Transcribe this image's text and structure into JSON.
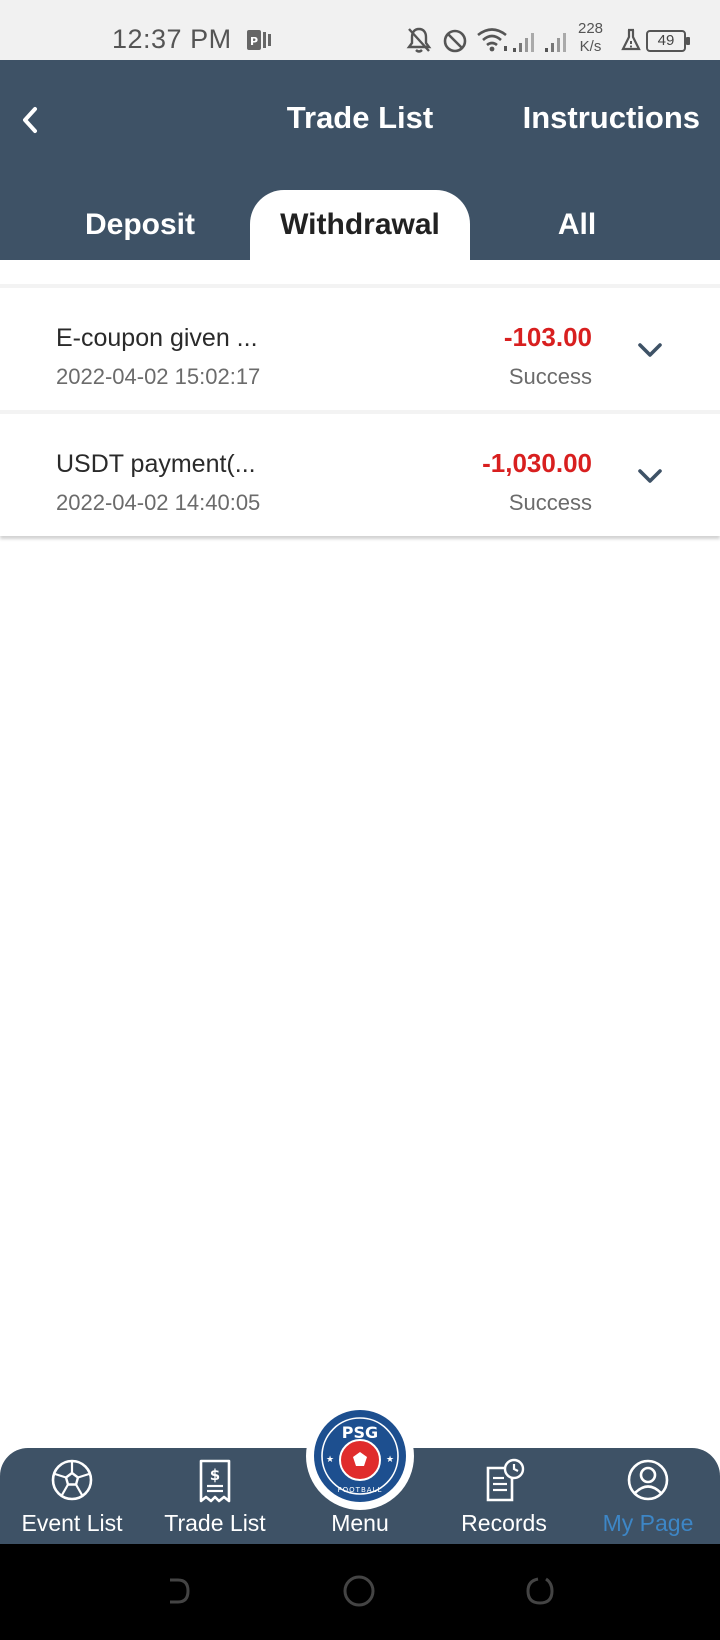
{
  "status_bar": {
    "time": "12:37 PM",
    "speed_value": "228",
    "speed_unit": "K/s",
    "battery": "49",
    "icons": [
      "notification-app-icon",
      "mute-icon",
      "do-not-disturb-icon",
      "wifi-icon",
      "signal-icon",
      "signal-icon",
      "flask-icon",
      "battery-icon"
    ]
  },
  "header": {
    "title": "Trade List",
    "instructions_label": "Instructions",
    "tabs": [
      {
        "label": "Deposit",
        "active": false
      },
      {
        "label": "Withdrawal",
        "active": true
      },
      {
        "label": "All",
        "active": false
      }
    ]
  },
  "transactions": [
    {
      "title": "E-coupon given ...",
      "date": "2022-04-02 15:02:17",
      "amount": "-103.00",
      "status": "Success"
    },
    {
      "title": "USDT payment(...",
      "date": "2022-04-02 14:40:05",
      "amount": "-1,030.00",
      "status": "Success"
    }
  ],
  "bottom_nav": {
    "items": [
      {
        "label": "Event List",
        "icon": "soccer-ball-icon"
      },
      {
        "label": "Trade List",
        "icon": "receipt-icon"
      },
      {
        "label": "Menu",
        "icon": "psg-logo"
      },
      {
        "label": "Records",
        "icon": "records-icon"
      },
      {
        "label": "My Page",
        "icon": "user-icon",
        "active": true
      }
    ],
    "logo_text": "PSG",
    "logo_subtext": "FOOTBALL"
  },
  "colors": {
    "header_bg": "#3e5266",
    "amount_red": "#d81f1f",
    "active_blue": "#3d86c6"
  }
}
